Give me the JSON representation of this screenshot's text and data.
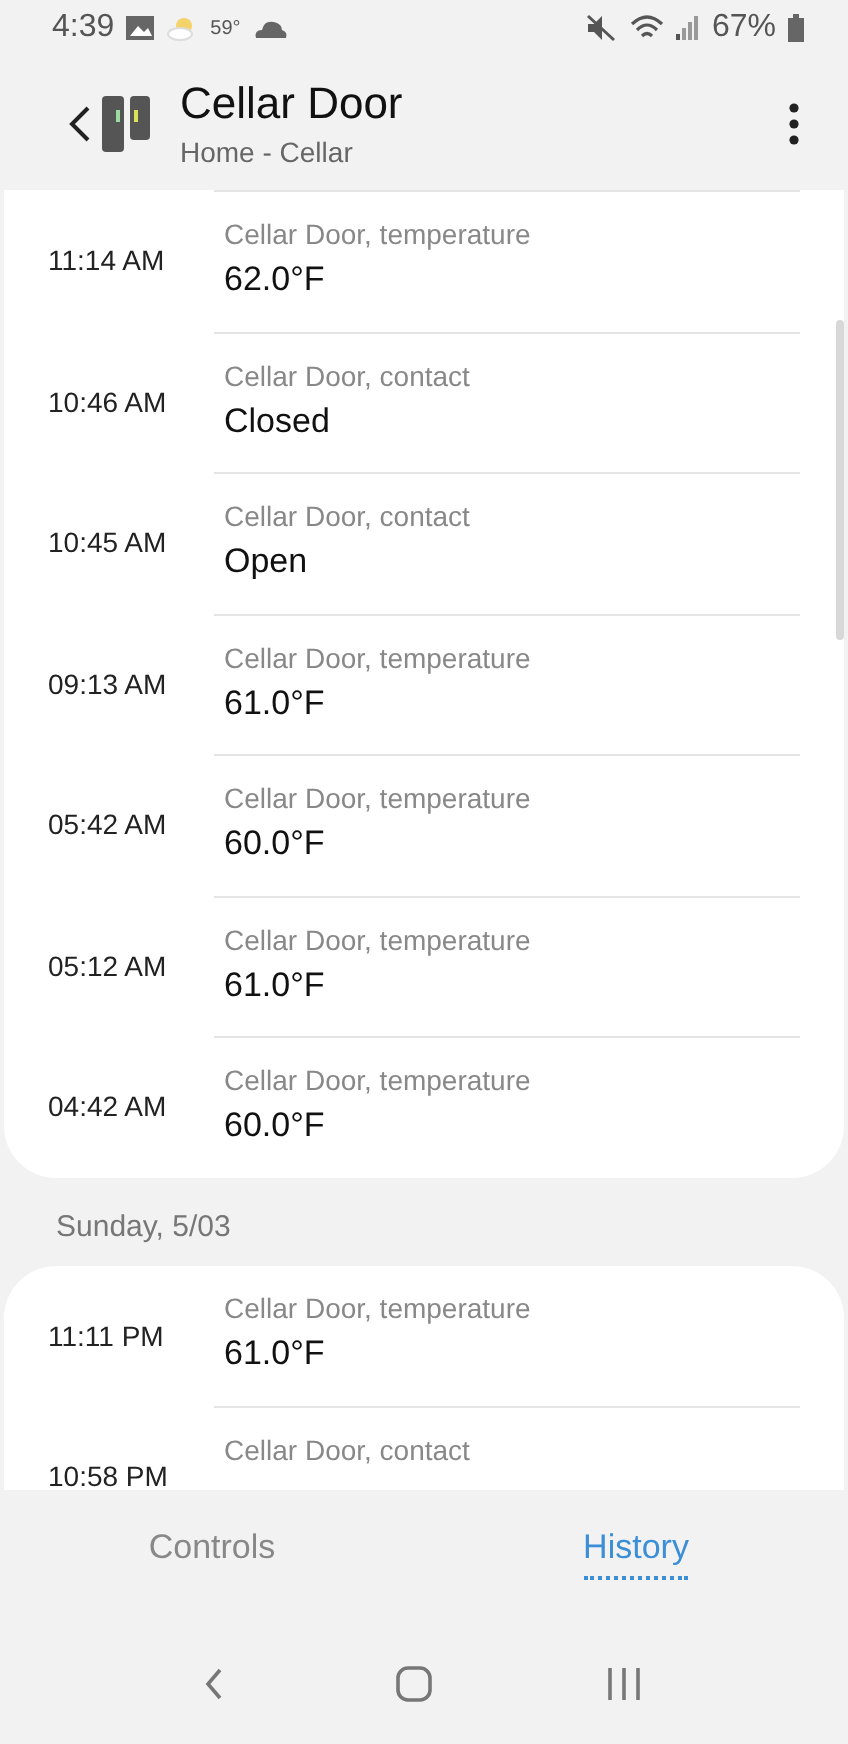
{
  "status_bar": {
    "time": "4:39",
    "temperature": "59°",
    "battery": "67%"
  },
  "header": {
    "title": "Cellar Door",
    "subtitle": "Home - Cellar"
  },
  "sections": [
    {
      "events": [
        {
          "time": "11:14 AM",
          "source": "Cellar Door, temperature",
          "value": "62.0°F"
        },
        {
          "time": "10:46 AM",
          "source": "Cellar Door, contact",
          "value": "Closed"
        },
        {
          "time": "10:45 AM",
          "source": "Cellar Door, contact",
          "value": "Open"
        },
        {
          "time": "09:13 AM",
          "source": "Cellar Door, temperature",
          "value": "61.0°F"
        },
        {
          "time": "05:42 AM",
          "source": "Cellar Door, temperature",
          "value": "60.0°F"
        },
        {
          "time": "05:12 AM",
          "source": "Cellar Door, temperature",
          "value": "61.0°F"
        },
        {
          "time": "04:42 AM",
          "source": "Cellar Door, temperature",
          "value": "60.0°F"
        }
      ]
    },
    {
      "day": "Sunday, 5/03",
      "events": [
        {
          "time": "11:11 PM",
          "source": "Cellar Door, temperature",
          "value": "61.0°F"
        },
        {
          "time": "10:58 PM",
          "source": "Cellar Door, contact"
        }
      ]
    }
  ],
  "tabs": [
    {
      "label": "Controls",
      "selected": false
    },
    {
      "label": "History",
      "selected": true
    }
  ]
}
